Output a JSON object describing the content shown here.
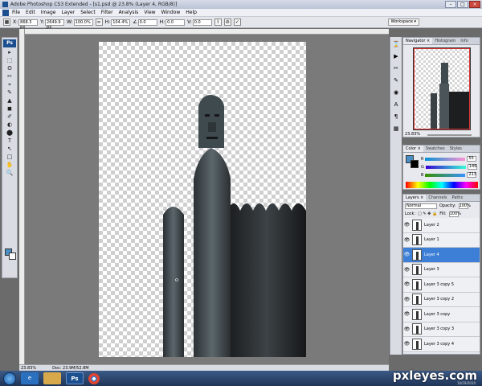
{
  "window": {
    "title": "Adobe Photoshop CS3 Extended - [s1.psd @ 23.8% (Layer 4, RGB/8)]"
  },
  "menu": [
    "File",
    "Edit",
    "Image",
    "Layer",
    "Select",
    "Filter",
    "Analysis",
    "View",
    "Window",
    "Help"
  ],
  "options": {
    "x_label": "X:",
    "x_value": "868.3 px",
    "y_label": "Y:",
    "y_value": "2649.9 px",
    "w_label": "W:",
    "w_value": "100.0%",
    "h_label": "H:",
    "h_value": "104.4%",
    "angle_value": "0.0",
    "h_skew_label": "H:",
    "h_skew_value": "0.0",
    "v_skew_label": "V:",
    "v_skew_value": "0.0",
    "workspace_label": "Workspace ▾"
  },
  "tools": [
    "▸",
    "⬚",
    "ʘ",
    "✂",
    "⌖",
    "✎",
    "▲",
    "◼",
    "✐",
    "◐",
    "⬤",
    "T",
    "↖",
    "□",
    "✋",
    "🔍"
  ],
  "status": {
    "zoom": "23.83%",
    "doc": "Doc: 23.9M/52.8M"
  },
  "navigator": {
    "tabs": [
      "Navigator ×",
      "Histogram",
      "Info"
    ],
    "zoom": "23.83%"
  },
  "color_panel": {
    "tabs": [
      "Color ×",
      "Swatches",
      "Styles"
    ],
    "rows": [
      {
        "label": "R",
        "value": "55"
      },
      {
        "label": "G",
        "value": "146"
      },
      {
        "label": "B",
        "value": "213"
      }
    ]
  },
  "layers_panel": {
    "tabs": [
      "Layers ×",
      "Channels",
      "Paths"
    ],
    "blend_mode": "Normal",
    "opacity_label": "Opacity:",
    "opacity_value": "100%",
    "lock_label": "Lock:",
    "fill_label": "Fill:",
    "fill_value": "100%",
    "layers": [
      {
        "name": "Layer 2",
        "selected": false
      },
      {
        "name": "Layer 1",
        "selected": false
      },
      {
        "name": "Layer 4",
        "selected": true
      },
      {
        "name": "Layer 3",
        "selected": false
      },
      {
        "name": "Layer 3 copy 5",
        "selected": false
      },
      {
        "name": "Layer 3 copy 2",
        "selected": false
      },
      {
        "name": "Layer 3 copy",
        "selected": false
      },
      {
        "name": "Layer 3 copy 3",
        "selected": false
      },
      {
        "name": "Layer 3 copy 4",
        "selected": false
      }
    ]
  },
  "watermark": {
    "text": "pxleyes.com",
    "date": "10/19/2010"
  }
}
